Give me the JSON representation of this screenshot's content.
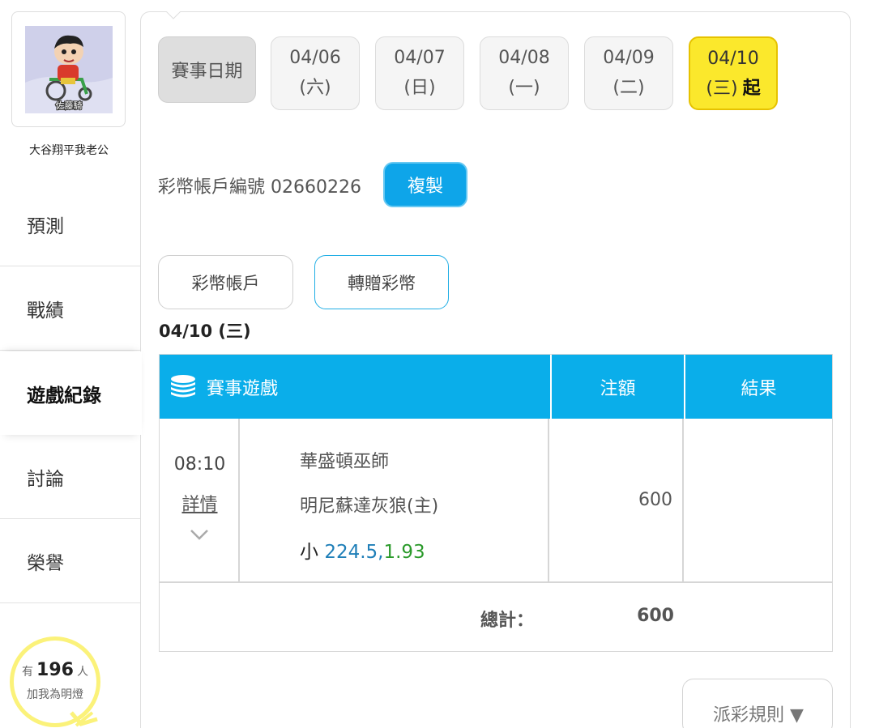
{
  "sidebar": {
    "username": "大谷翔平我老公",
    "avatar_caption": "佐藤騎",
    "items": [
      {
        "label": "預測"
      },
      {
        "label": "戰績"
      },
      {
        "label": "遊戲紀錄"
      },
      {
        "label": "討論"
      },
      {
        "label": "榮譽"
      }
    ],
    "fans": {
      "prefix": "有",
      "count": "196",
      "suffix": "人",
      "line2": "加我為明燈"
    }
  },
  "dates": {
    "label": "賽事日期",
    "items": [
      {
        "date": "04/06",
        "weekday": "(六)"
      },
      {
        "date": "04/07",
        "weekday": "(日)"
      },
      {
        "date": "04/08",
        "weekday": "(一)"
      },
      {
        "date": "04/09",
        "weekday": "(二)"
      },
      {
        "date": "04/10",
        "weekday": "(三)",
        "suffix": "起"
      }
    ]
  },
  "account": {
    "label": "彩幣帳戶編號 02660226",
    "copy": "複製"
  },
  "tabs": [
    "彩幣帳戶",
    "轉贈彩幣"
  ],
  "selected_date": "04/10 (三)",
  "table": {
    "headers": {
      "game": "賽事遊戲",
      "bet": "注額",
      "result": "結果"
    },
    "rows": [
      {
        "time": "08:10",
        "detail": "詳情",
        "team1": "華盛頓巫師",
        "team2": "明尼蘇達灰狼(主)",
        "pick_type": "小",
        "pick_line": "224.5,",
        "pick_odds": "1.93",
        "bet": "600",
        "result": ""
      }
    ],
    "total_label": "總計：",
    "total_value": "600"
  },
  "rules_button": "派彩規則 ▼",
  "colors": {
    "accent": "#0aaeea",
    "selected_date": "#fbe82c",
    "fan_ring": "#fbf27a"
  }
}
